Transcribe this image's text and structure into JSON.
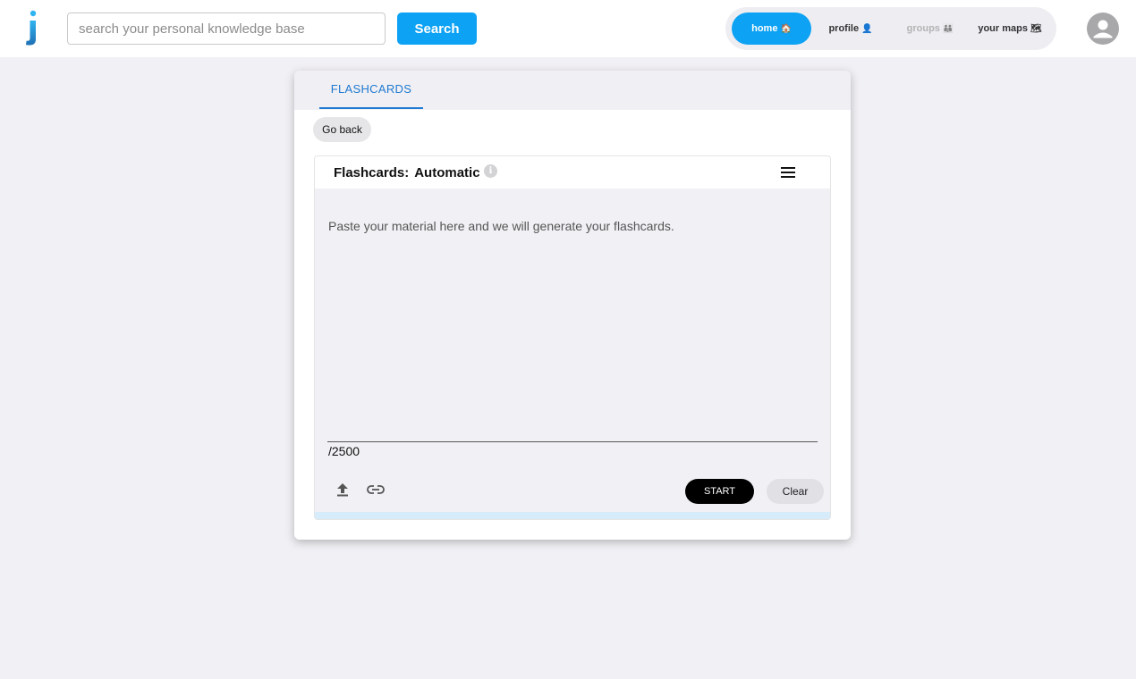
{
  "header": {
    "logo_icon": "j-logo-icon",
    "search": {
      "placeholder": "search your personal knowledge base",
      "value": ""
    },
    "search_button_label": "Search",
    "nav": [
      {
        "label": "home",
        "emoji": "🏠",
        "state": "active"
      },
      {
        "label": "profile",
        "emoji": "👤",
        "state": "normal"
      },
      {
        "label": "groups",
        "emoji": "👪",
        "state": "disabled"
      },
      {
        "label": "your maps",
        "emoji": "🗺",
        "state": "normal"
      }
    ],
    "avatar_icon": "user-avatar-icon"
  },
  "card": {
    "tab_label": "FLASHCARDS",
    "back_button_label": "Go back",
    "panel": {
      "title": "Flashcards:",
      "mode": "Automatic",
      "info_icon": "info-icon",
      "menu_icon": "hamburger-menu-icon",
      "textarea_placeholder": "Paste your material here and we will generate your flashcards.",
      "textarea_value": "",
      "counter": "/2500",
      "upload_icon": "upload-icon",
      "link_icon": "link-icon",
      "start_label": "START",
      "clear_label": "Clear"
    }
  },
  "colors": {
    "accent": "#0da2f4",
    "tab_accent": "#1f7ad1",
    "background": "#f1f0f4",
    "progress_track": "#d7ecfb"
  }
}
